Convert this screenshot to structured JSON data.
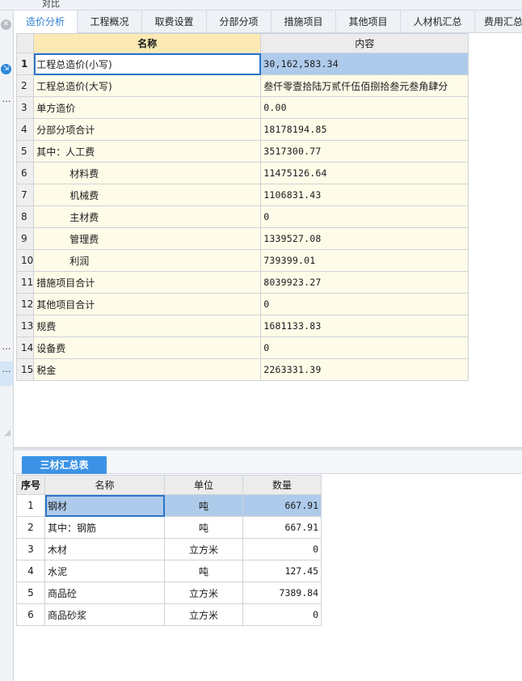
{
  "window": {
    "title": "对比"
  },
  "tabs": [
    {
      "label": "造价分析",
      "active": true
    },
    {
      "label": "工程概况"
    },
    {
      "label": "取费设置"
    },
    {
      "label": "分部分项"
    },
    {
      "label": "措施项目"
    },
    {
      "label": "其他项目"
    },
    {
      "label": "人材机汇总"
    },
    {
      "label": "费用汇总"
    }
  ],
  "cost_table": {
    "headers": {
      "name": "名称",
      "content": "内容"
    },
    "rows": [
      {
        "no": "1",
        "name": "工程总造价(小写)",
        "value": "30,162,583.34"
      },
      {
        "no": "2",
        "name": "工程总造价(大写)",
        "value": "叁仟零壹拾陆万贰仟伍佰捌拾叁元叁角肆分"
      },
      {
        "no": "3",
        "name": "单方造价",
        "value": "0.00"
      },
      {
        "no": "4",
        "name": "分部分项合计",
        "value": "18178194.85"
      },
      {
        "no": "5",
        "name": "其中：人工费",
        "value": "3517300.77"
      },
      {
        "no": "6",
        "name": "材料费",
        "value": "11475126.64"
      },
      {
        "no": "7",
        "name": "机械费",
        "value": "1106831.43"
      },
      {
        "no": "8",
        "name": "主材费",
        "value": "0"
      },
      {
        "no": "9",
        "name": "管理费",
        "value": "1339527.08"
      },
      {
        "no": "10",
        "name": "利润",
        "value": "739399.01"
      },
      {
        "no": "11",
        "name": "措施项目合计",
        "value": "8039923.27"
      },
      {
        "no": "12",
        "name": "其他项目合计",
        "value": "0"
      },
      {
        "no": "13",
        "name": "规费",
        "value": "1681133.83"
      },
      {
        "no": "14",
        "name": "设备费",
        "value": "0"
      },
      {
        "no": "15",
        "name": "税金",
        "value": "2263331.39"
      }
    ]
  },
  "bottom_tabs": [
    {
      "label": "三材汇总表",
      "active": true
    }
  ],
  "materials_table": {
    "headers": {
      "seq": "序号",
      "name": "名称",
      "unit": "单位",
      "qty": "数量"
    },
    "rows": [
      {
        "seq": "1",
        "name": "钢材",
        "unit": "吨",
        "qty": "667.91"
      },
      {
        "seq": "2",
        "name": "其中：钢筋",
        "unit": "吨",
        "qty": "667.91"
      },
      {
        "seq": "3",
        "name": "木材",
        "unit": "立方米",
        "qty": "0"
      },
      {
        "seq": "4",
        "name": "水泥",
        "unit": "吨",
        "qty": "127.45"
      },
      {
        "seq": "5",
        "name": "商品砼",
        "unit": "立方米",
        "qty": "7389.84"
      },
      {
        "seq": "6",
        "name": "商品砂浆",
        "unit": "立方米",
        "qty": "0"
      }
    ]
  },
  "colors": {
    "accent": "#2e7fd1",
    "selection": "#aecbeb",
    "cell_bg": "#fefbe8",
    "header_highlight": "#fde9b4",
    "tab_button": "#3c93e6"
  }
}
